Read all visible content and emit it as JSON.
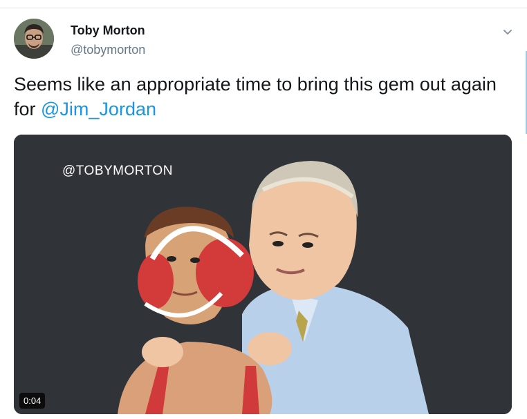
{
  "tweet": {
    "author": {
      "display_name": "Toby Morton",
      "handle": "@tobymorton"
    },
    "text_before": "Seems like an appropriate time to bring this gem out again for ",
    "mention": "@Jim_Jordan",
    "media": {
      "watermark": "@TOBYMORTON",
      "duration": "0:04"
    }
  },
  "icons": {
    "more": "chevron-down-icon"
  },
  "colors": {
    "link": "#1b95e0",
    "text": "#14171a",
    "secondary": "#657786",
    "divider": "#e1e8ed"
  }
}
